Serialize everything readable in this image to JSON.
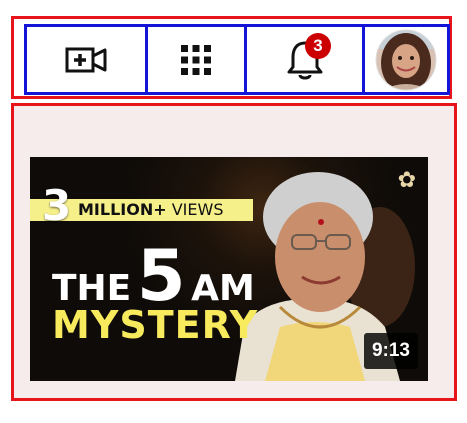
{
  "toolbar": {
    "create_icon": "video-camera-plus-icon",
    "apps_icon": "apps-grid-icon",
    "notifications_icon": "bell-icon",
    "notification_count": "3",
    "avatar_icon": "user-avatar"
  },
  "video": {
    "badge_number": "3",
    "badge_million": "MILLION+",
    "badge_views": "VIEWS",
    "title_the": "THE",
    "title_five": "5",
    "title_am": "AM",
    "title_mystery": "MYSTERY",
    "duration": "9:13",
    "logo_icon": "lotus-logo-icon"
  },
  "colors": {
    "outline_red": "#e8141c",
    "outline_blue": "#1414d8",
    "badge_red": "#cc0000",
    "title_yellow": "#f7ea5c",
    "views_banner": "#f6f08a"
  }
}
